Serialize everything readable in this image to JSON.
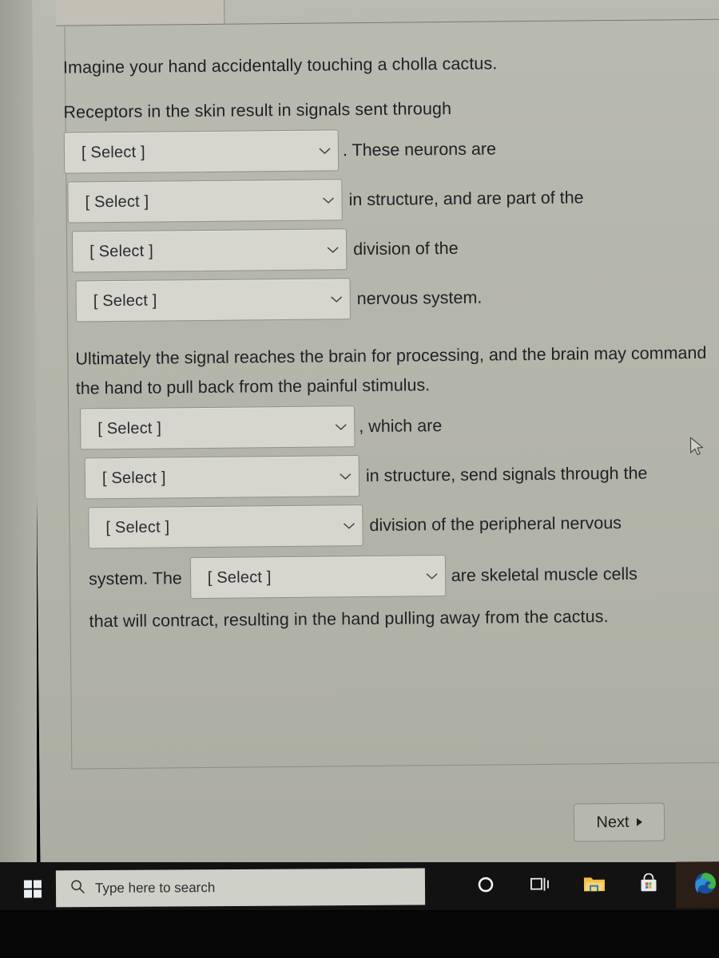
{
  "question": {
    "intro": "Imagine your hand accidentally touching a cholla cactus.",
    "line1": "Receptors in the skin result in signals sent through",
    "paragraph": "Ultimately the signal reaches the brain for processing, and the brain may command the hand to pull back from the painful stimulus.",
    "select_placeholder": "[ Select ]",
    "blanks": [
      {
        "id": "blank-1",
        "value": "[ Select ]",
        "after": ". These neurons are"
      },
      {
        "id": "blank-2",
        "value": "[ Select ]",
        "after": "in structure, and are part of the"
      },
      {
        "id": "blank-3",
        "value": "[ Select ]",
        "after": "division of the"
      },
      {
        "id": "blank-4",
        "value": "[ Select ]",
        "after": "nervous system."
      },
      {
        "id": "blank-5",
        "value": "[ Select ]",
        "after": ", which are"
      },
      {
        "id": "blank-6",
        "value": "[ Select ]",
        "after": "in structure, send signals through the"
      },
      {
        "id": "blank-7",
        "value": "[ Select ]",
        "after": "division of the peripheral nervous"
      },
      {
        "id": "blank-8",
        "before": "system. The",
        "value": "[ Select ]",
        "after": "are skeletal muscle cells"
      }
    ],
    "closing": "that will contract, resulting in the hand pulling away from the cactus."
  },
  "footer": {
    "next_label": "Next",
    "next_icon": "play-triangle-icon"
  },
  "taskbar": {
    "start_icon": "windows-logo-icon",
    "search_icon": "search-icon",
    "search_placeholder": "Type here to search",
    "icons": [
      {
        "name": "cortana-circle-icon"
      },
      {
        "name": "task-view-icon"
      },
      {
        "name": "file-explorer-icon"
      },
      {
        "name": "microsoft-store-icon"
      },
      {
        "name": "microsoft-edge-icon"
      }
    ]
  },
  "colors": {
    "page_background": "#b4b5aa",
    "select_fill": "#d6d5ce",
    "select_border": "#8f9088",
    "text": "#202226",
    "taskbar": "#121212",
    "folder_yellow": "#f2c14a"
  }
}
